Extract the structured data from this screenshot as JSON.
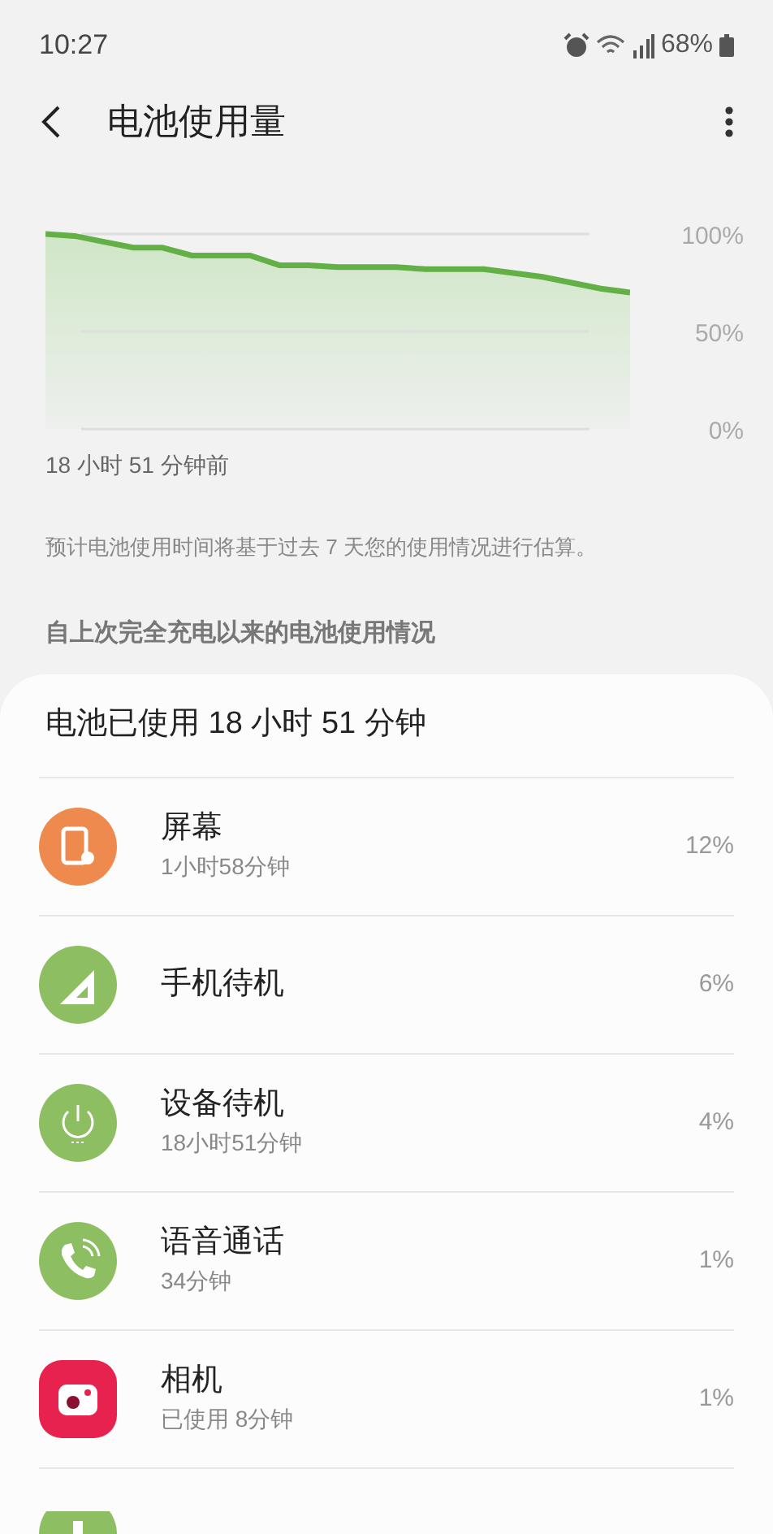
{
  "status_bar": {
    "time": "10:27",
    "battery": "68%"
  },
  "header": {
    "title": "电池使用量"
  },
  "chart": {
    "y_labels": [
      "100%",
      "50%",
      "0%"
    ],
    "start_label": "18 小时 51 分钟前"
  },
  "note": "预计电池使用时间将基于过去 7 天您的使用情况进行估算。",
  "section_title": "自上次完全充电以来的电池使用情况",
  "usage": {
    "total": "电池已使用 18 小时 51 分钟",
    "items": [
      {
        "kind": "screen",
        "color": "#ee8a4d",
        "name": "屏幕",
        "detail": "1小时58分钟",
        "percent": "12%"
      },
      {
        "kind": "signal",
        "color": "#8dbe62",
        "name": "手机待机",
        "percent": "6%"
      },
      {
        "kind": "power",
        "color": "#8dbe62",
        "name": "设备待机",
        "detail": "18小时51分钟",
        "percent": "4%"
      },
      {
        "kind": "call",
        "color": "#8dbe62",
        "name": "语音通话",
        "detail": "34分钟",
        "percent": "1%"
      },
      {
        "kind": "camera",
        "color": "#e8224e",
        "name": "相机",
        "detail": "已使用 8分钟",
        "percent": "1%"
      },
      {
        "kind": "partial",
        "color": "#8dbe62"
      }
    ]
  }
}
